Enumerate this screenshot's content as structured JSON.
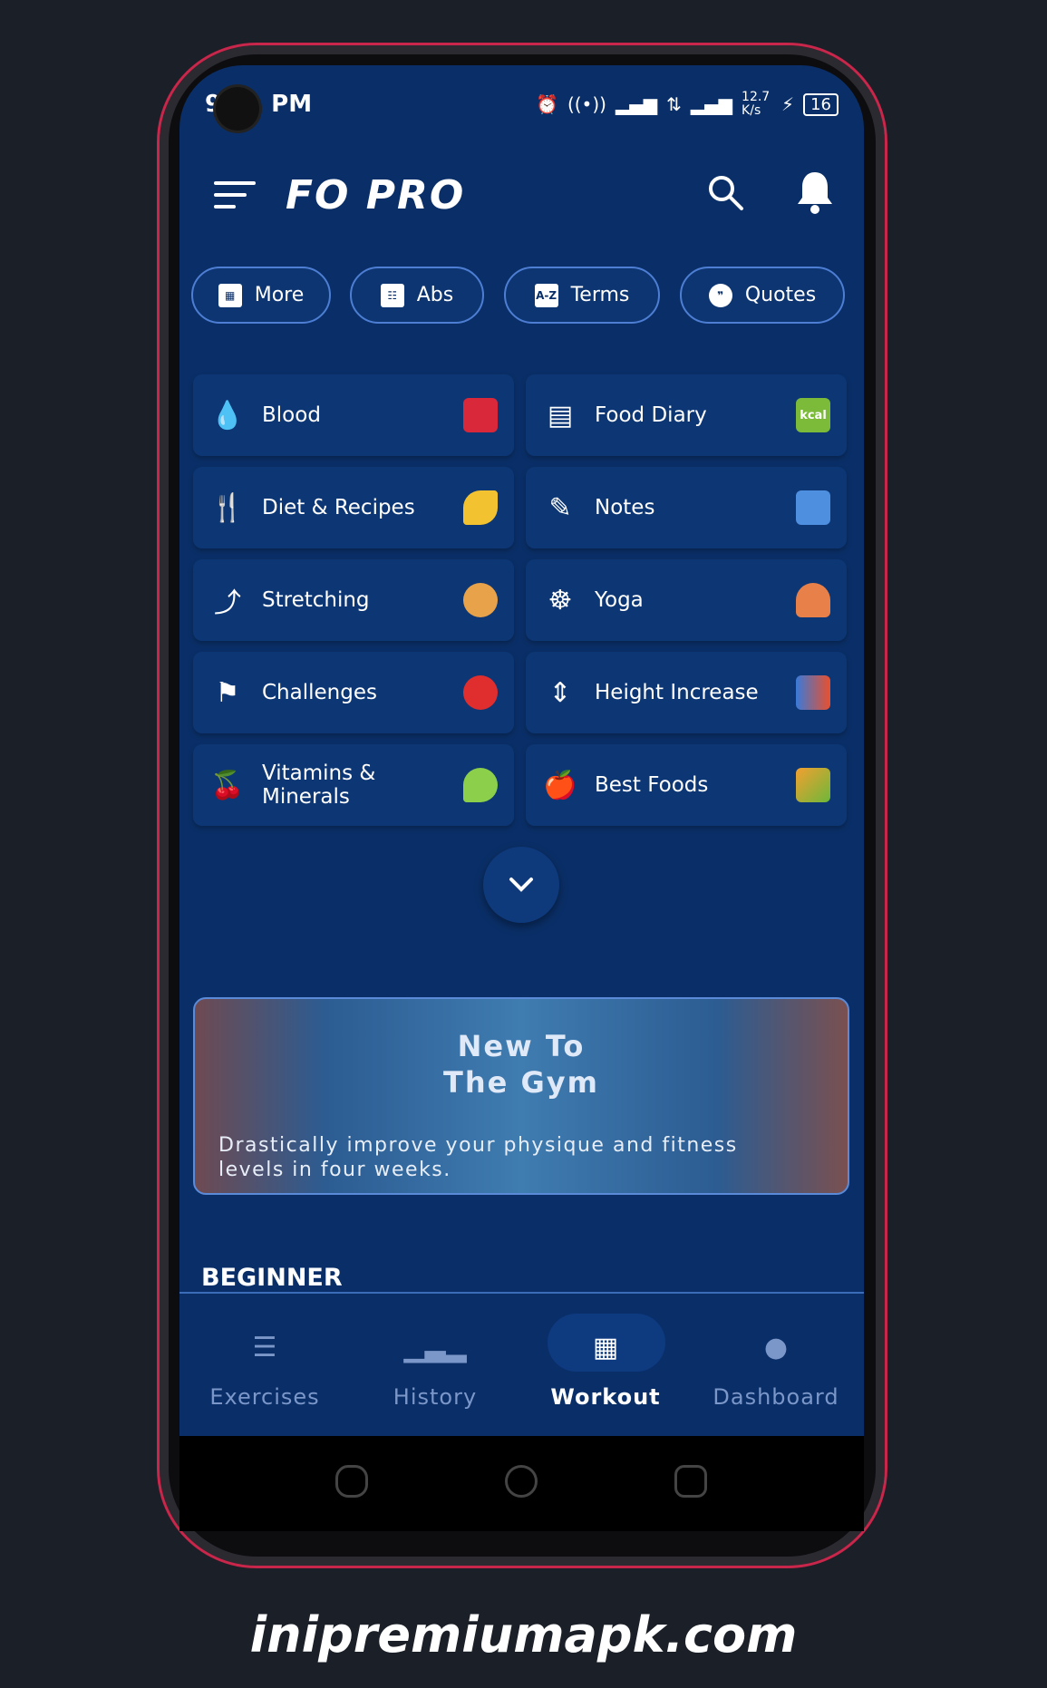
{
  "status_bar": {
    "time_prefix": "9",
    "time_suffix": "PM",
    "icons": [
      "alarm-icon",
      "hotspot-icon",
      "signal-icon",
      "data-icon",
      "4g-signal-icon"
    ],
    "speed": "12.7 K/s",
    "battery": "16"
  },
  "header": {
    "title": "FO PRO",
    "menu_icon": "menu-icon",
    "search_icon": "search-icon",
    "bell_icon": "bell-icon"
  },
  "chips": [
    {
      "label": "More",
      "icon": "grid-icon"
    },
    {
      "label": "Abs",
      "icon": "abs-icon"
    },
    {
      "label": "Terms",
      "icon": "az-book-icon"
    },
    {
      "label": "Quotes",
      "icon": "quote-bubble-icon"
    }
  ],
  "tiles": [
    {
      "label": "Blood",
      "icon": "blood-drops-icon",
      "badge": "blood-pressure"
    },
    {
      "label": "Food Diary",
      "icon": "notebook-icon",
      "badge": "kcal"
    },
    {
      "label": "Diet & Recipes",
      "icon": "fork-knife-icon",
      "badge": "banana"
    },
    {
      "label": "Notes",
      "icon": "clipboard-pen-icon",
      "badge": "notepad"
    },
    {
      "label": "Stretching",
      "icon": "stretch-icon",
      "badge": "stretching-person"
    },
    {
      "label": "Yoga",
      "icon": "yoga-icon",
      "badge": "yoga-person"
    },
    {
      "label": "Challenges",
      "icon": "challenge-icon",
      "badge": "karate"
    },
    {
      "label": "Height Increase",
      "icon": "height-icon",
      "badge": "height-people"
    },
    {
      "label": "Vitamins & Minerals",
      "icon": "fruit-icon",
      "badge": "lettuce"
    },
    {
      "label": "Best Foods",
      "icon": "apple-scale-icon",
      "badge": "vegetables"
    }
  ],
  "banner": {
    "title_line1": "New To",
    "title_line2": "The Gym",
    "description_line1": "Drastically improve your physique and fitness",
    "description_line2": "levels in four weeks."
  },
  "section": {
    "title": "BEGINNER"
  },
  "bottom_nav": [
    {
      "label": "Exercises",
      "active": false
    },
    {
      "label": "History",
      "active": false
    },
    {
      "label": "Workout",
      "active": true
    },
    {
      "label": "Dashboard",
      "active": false
    }
  ],
  "colors": {
    "background": "#0a2f68",
    "tile": "#0d3774",
    "chip_border": "#4d7ed3",
    "inactive_nav": "#7b96c8",
    "frame_accent": "#c8264a"
  },
  "watermark": "inipremiumapk.com"
}
